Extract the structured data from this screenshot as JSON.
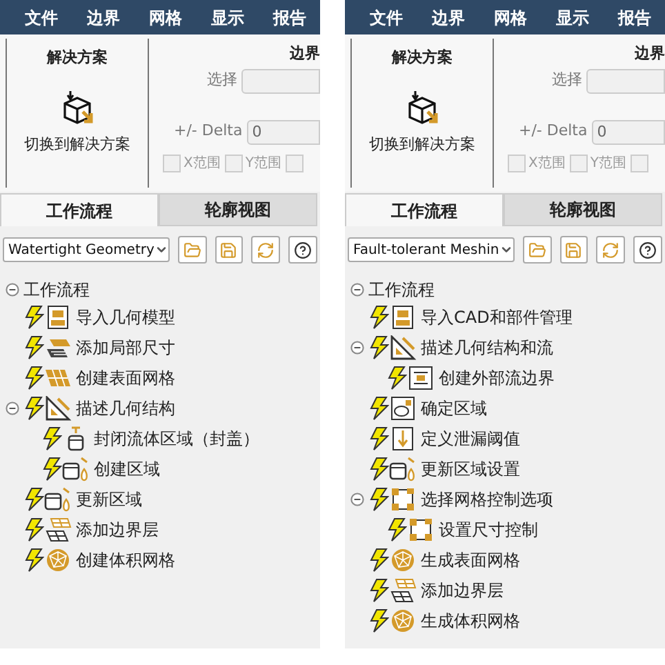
{
  "panels": [
    {
      "menu": [
        "文件",
        "边界",
        "网格",
        "显示",
        "报告"
      ],
      "ribbon": {
        "group_title": "解决方案",
        "switch_button": "切换到解决方案",
        "boundary_title": "边界",
        "select_label": "选择",
        "delta_label": "+/- Delta",
        "delta_value": "0",
        "checkboxes": [
          {
            "label": "X范围",
            "checked": false,
            "disabled": true
          },
          {
            "label": "Y范围",
            "checked": false,
            "disabled": true
          },
          {
            "checked": false,
            "disabled": true
          }
        ]
      },
      "tabs": [
        {
          "label": "工作流程",
          "selected": true
        },
        {
          "label": "轮廓视图",
          "selected": false
        }
      ],
      "workflow_select": {
        "value": "Watertight Geometry"
      },
      "tree": {
        "label": "工作流程",
        "expanded": true,
        "children": [
          {
            "label": "导入几何模型",
            "kind": "cad"
          },
          {
            "label": "添加局部尺寸",
            "kind": "local-size"
          },
          {
            "label": "创建表面网格",
            "kind": "surface-mesh"
          },
          {
            "label": "描述几何结构",
            "kind": "geometry",
            "expanded": true,
            "children": [
              {
                "label": "封闭流体区域（封盖）",
                "kind": "cap"
              },
              {
                "label": "创建区域",
                "kind": "create-region"
              }
            ]
          },
          {
            "label": "更新区域",
            "kind": "update-region"
          },
          {
            "label": "添加边界层",
            "kind": "boundary-layer"
          },
          {
            "label": "创建体积网格",
            "kind": "sphere-mesh"
          }
        ]
      }
    },
    {
      "menu": [
        "文件",
        "边界",
        "网格",
        "显示",
        "报告"
      ],
      "ribbon": {
        "group_title": "解决方案",
        "switch_button": "切换到解决方案",
        "boundary_title": "边界",
        "select_label": "选择",
        "delta_label": "+/- Delta",
        "delta_value": "0",
        "checkboxes": [
          {
            "label": "X范围",
            "checked": false,
            "disabled": true
          },
          {
            "label": "Y范围",
            "checked": false,
            "disabled": true
          },
          {
            "checked": false,
            "disabled": true
          }
        ]
      },
      "tabs": [
        {
          "label": "工作流程",
          "selected": true
        },
        {
          "label": "轮廓视图",
          "selected": false
        }
      ],
      "workflow_select": {
        "value": "Fault-tolerant Meshin"
      },
      "tree": {
        "label": "工作流程",
        "expanded": true,
        "children": [
          {
            "label": "导入CAD和部件管理",
            "kind": "cad"
          },
          {
            "label": "描述几何结构和流",
            "kind": "geometry",
            "expanded": true,
            "children": [
              {
                "label": "创建外部流边界",
                "kind": "external-flow"
              }
            ]
          },
          {
            "label": "确定区域",
            "kind": "identify-region"
          },
          {
            "label": "定义泄漏阈值",
            "kind": "leak"
          },
          {
            "label": "更新区域设置",
            "kind": "update-region"
          },
          {
            "label": "选择网格控制选项",
            "kind": "mesh-control",
            "expanded": true,
            "children": [
              {
                "label": "设置尺寸控制",
                "kind": "mesh-control"
              }
            ]
          },
          {
            "label": "生成表面网格",
            "kind": "sphere-mesh"
          },
          {
            "label": "添加边界层",
            "kind": "boundary-layer"
          },
          {
            "label": "生成体积网格",
            "kind": "sphere-mesh"
          }
        ]
      }
    }
  ]
}
